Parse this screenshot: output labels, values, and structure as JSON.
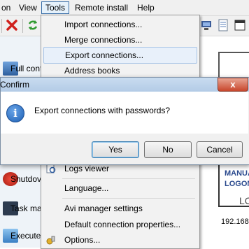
{
  "menubar": {
    "items": [
      {
        "label": "on"
      },
      {
        "label": "View"
      },
      {
        "label": "Tools"
      },
      {
        "label": "Remote install"
      },
      {
        "label": "Help"
      }
    ]
  },
  "left_panel": {
    "items": [
      {
        "label": "Full contr"
      },
      {
        "label": "Shutdov"
      },
      {
        "label": "Task mar"
      },
      {
        "label": "Execute"
      }
    ]
  },
  "tools_menu": {
    "items": [
      {
        "label": "Import connections..."
      },
      {
        "label": "Merge connections..."
      },
      {
        "label": "Export connections..."
      },
      {
        "label": "Address books"
      },
      {
        "label": "Logs viewer"
      },
      {
        "label": "Language..."
      },
      {
        "label": "Avi manager settings"
      },
      {
        "label": "Default connection properties..."
      },
      {
        "label": "Options..."
      }
    ]
  },
  "right_panel": {
    "link1": "MANUA",
    "link2": "LOGON",
    "text1": "LC",
    "ip": "192.168"
  },
  "dialog": {
    "title": "Confirm",
    "close_label": "x",
    "info_glyph": "i",
    "message": "Export connections with passwords?",
    "buttons": {
      "yes": "Yes",
      "no": "No",
      "cancel": "Cancel"
    }
  }
}
